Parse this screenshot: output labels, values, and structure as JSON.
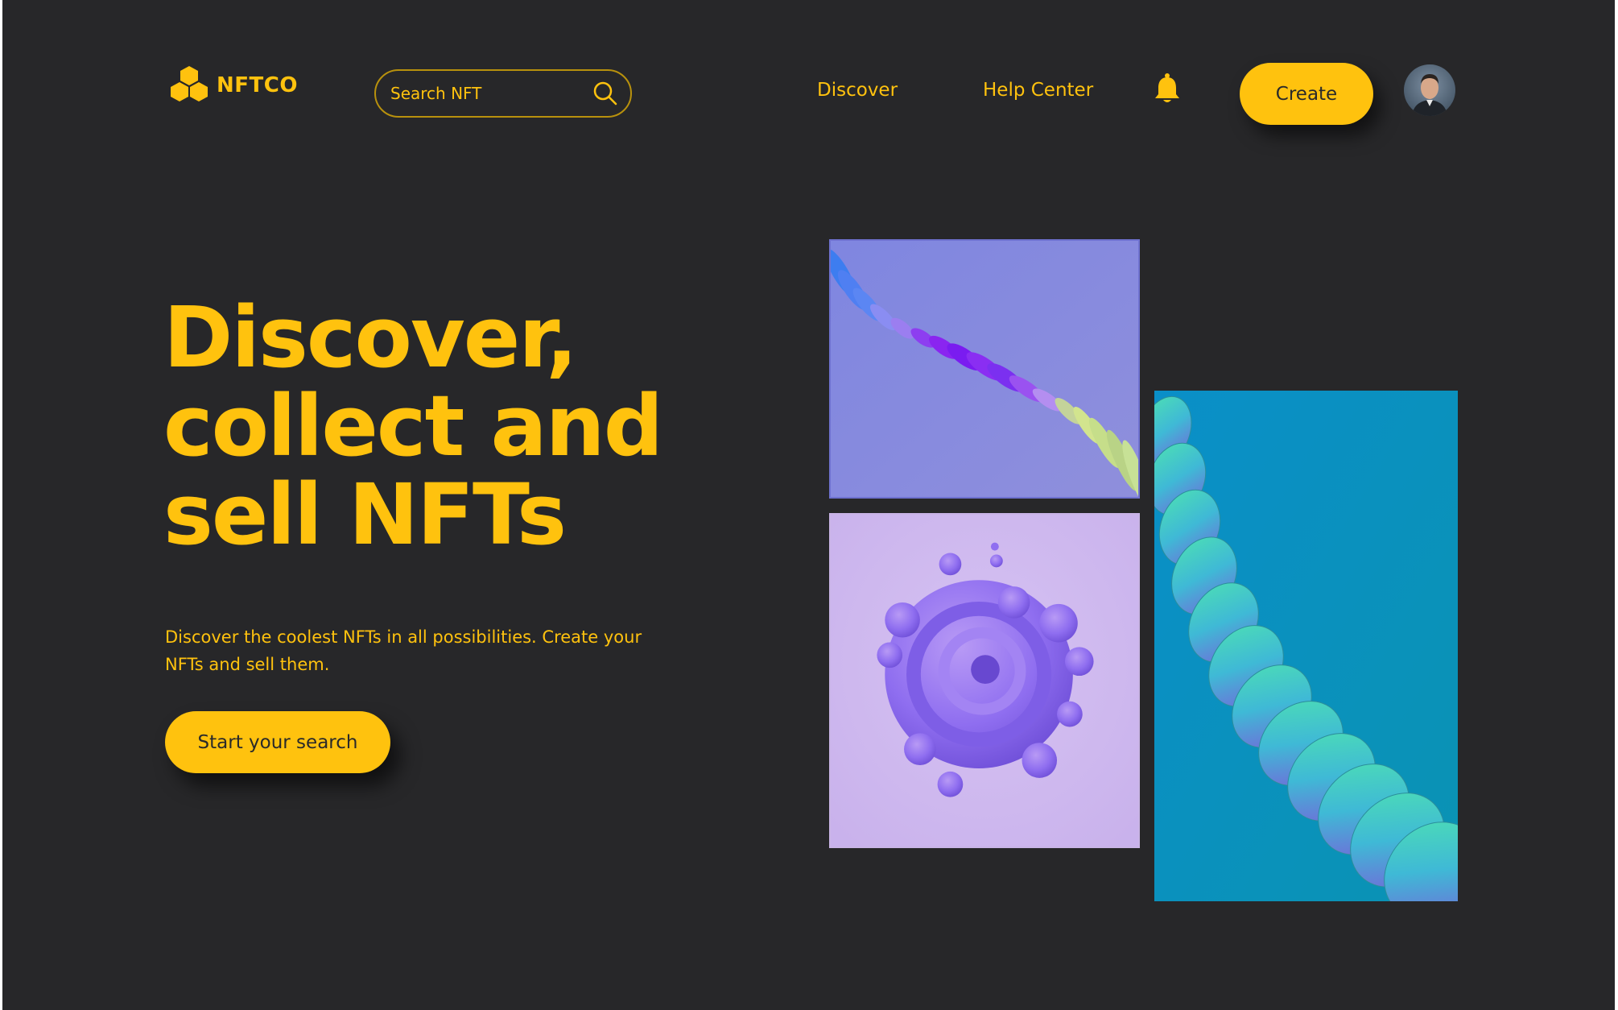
{
  "header": {
    "brand": "NFTCO",
    "logo_icon": "honeycomb-logo-icon",
    "search": {
      "placeholder": "Search NFT",
      "icon": "search-icon"
    },
    "nav": [
      {
        "label": "Discover"
      },
      {
        "label": "Help Center"
      }
    ],
    "notification_icon": "bell-icon",
    "create_label": "Create",
    "avatar": "user-avatar"
  },
  "hero": {
    "title_lines": [
      "Discover,",
      "collect and",
      "sell NFTs"
    ],
    "description": "Discover the coolest NFTs in all possibilities. Create your NFTs and sell them.",
    "cta_label": "Start your search"
  },
  "gallery": [
    {
      "name": "purple-spiral-ribbon-art"
    },
    {
      "name": "violet-bubble-swirl-art"
    },
    {
      "name": "teal-wave-ribbon-art"
    }
  ],
  "colors": {
    "background": "#272729",
    "accent": "#ffc20e",
    "button_text": "#2a2a2a"
  }
}
